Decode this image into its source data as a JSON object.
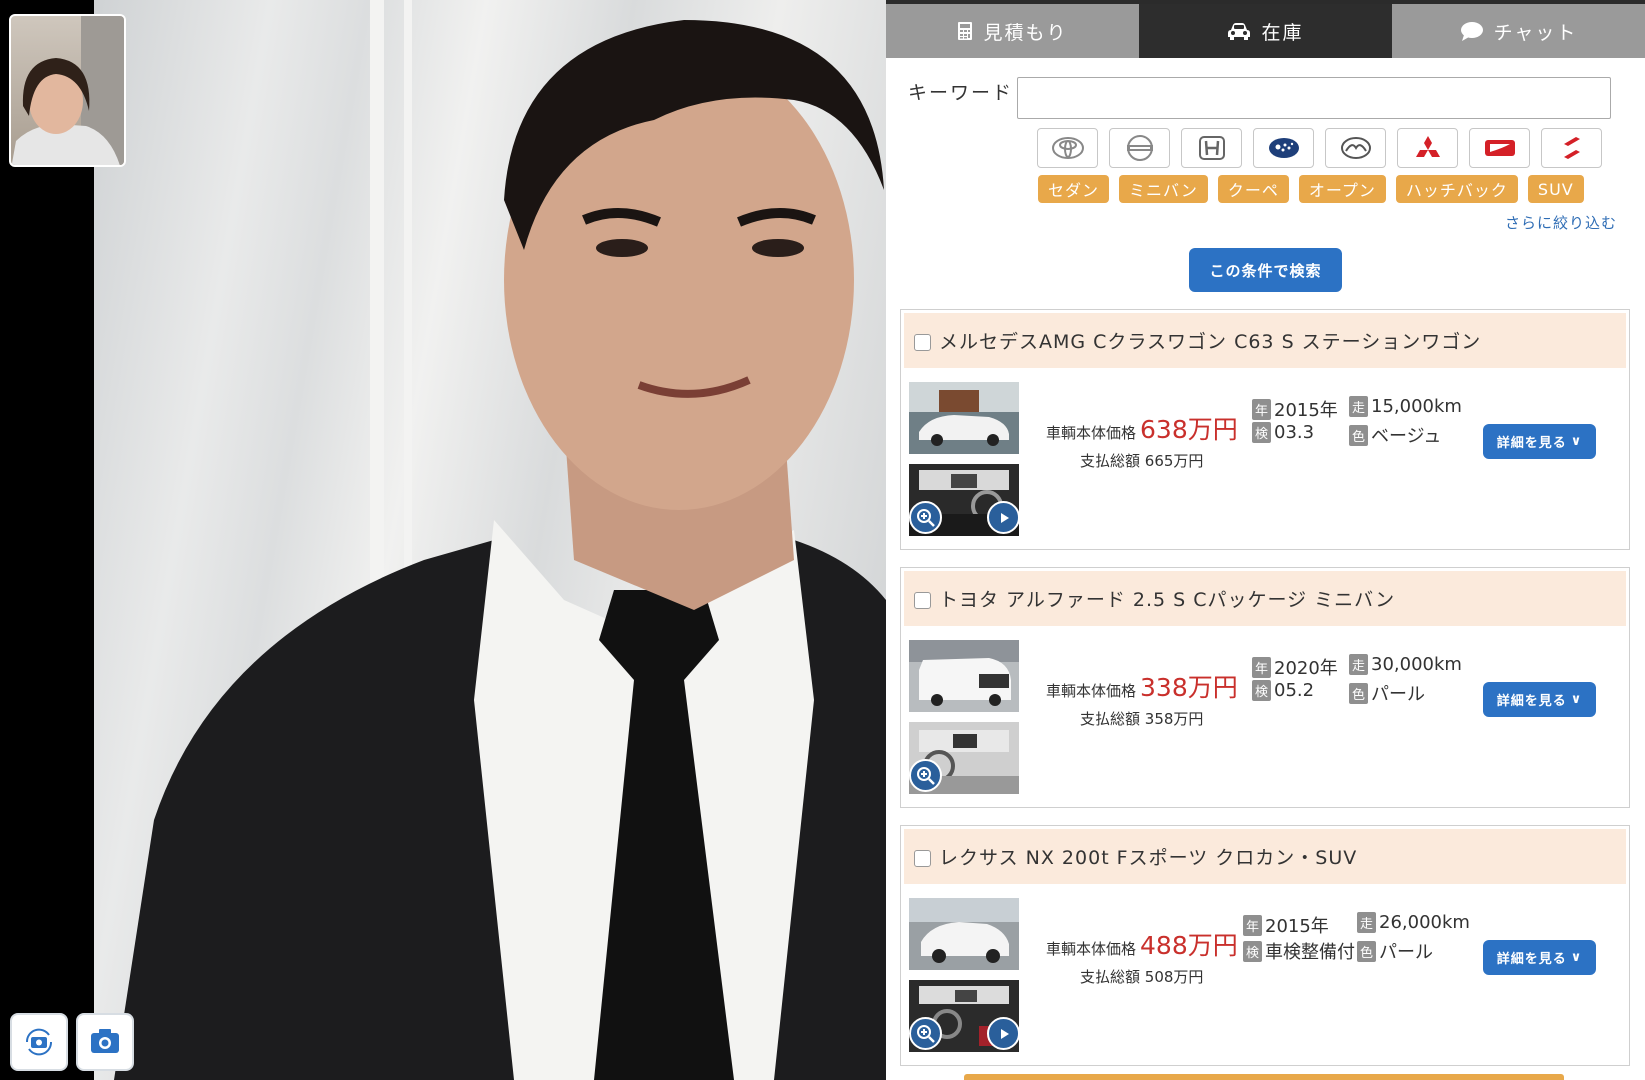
{
  "tabs": [
    {
      "label": "見積もり",
      "icon": "calculator-icon",
      "active": false
    },
    {
      "label": "在庫",
      "icon": "car-icon",
      "active": true
    },
    {
      "label": "チャット",
      "icon": "chat-bubble-icon",
      "active": false
    }
  ],
  "search": {
    "keyword_label": "キーワード",
    "keyword_value": "",
    "makers": [
      "toyota-logo",
      "nissan-logo",
      "honda-logo",
      "subaru-logo",
      "mazda-logo",
      "mitsubishi-logo",
      "daihatsu-logo",
      "suzuki-logo"
    ],
    "body_types": [
      "セダン",
      "ミニバン",
      "クーペ",
      "オープン",
      "ハッチバック",
      "SUV"
    ],
    "more_filters": "さらに絞り込む",
    "submit": "この条件で検索"
  },
  "cars": [
    {
      "name": "メルセデスAMG Cクラスワゴン C63 S ステーションワゴン",
      "price_label": "車輌本体価格",
      "price": "638万円",
      "total_label": "支払総額",
      "total": "665万円",
      "year_tag": "年",
      "year": "2015年",
      "inspection_tag": "検",
      "inspection": "03.3",
      "mileage_tag": "走",
      "mileage": "15,000km",
      "color_tag": "色",
      "color": "ベージュ",
      "detail": "詳細を見る",
      "has_video": true
    },
    {
      "name": "トヨタ アルファード 2.5 S Cパッケージ ミニバン",
      "price_label": "車輌本体価格",
      "price": "338万円",
      "total_label": "支払総額",
      "total": "358万円",
      "year_tag": "年",
      "year": "2020年",
      "inspection_tag": "検",
      "inspection": "05.2",
      "mileage_tag": "走",
      "mileage": "30,000km",
      "color_tag": "色",
      "color": "パール",
      "detail": "詳細を見る",
      "has_video": false
    },
    {
      "name": "レクサス NX 200t Fスポーツ クロカン・SUV",
      "price_label": "車輌本体価格",
      "price": "488万円",
      "total_label": "支払総額",
      "total": "508万円",
      "year_tag": "年",
      "year": "2015年",
      "inspection_tag": "検",
      "inspection": "車検整備付",
      "mileage_tag": "走",
      "mileage": "26,000km",
      "color_tag": "色",
      "color": "パール",
      "detail": "詳細を見る",
      "has_video": true
    }
  ],
  "colors": {
    "accent_blue": "#2c72c4",
    "price_red": "#c9302c",
    "tag_orange": "#e8a84a",
    "header_peach": "#fbeadc"
  }
}
